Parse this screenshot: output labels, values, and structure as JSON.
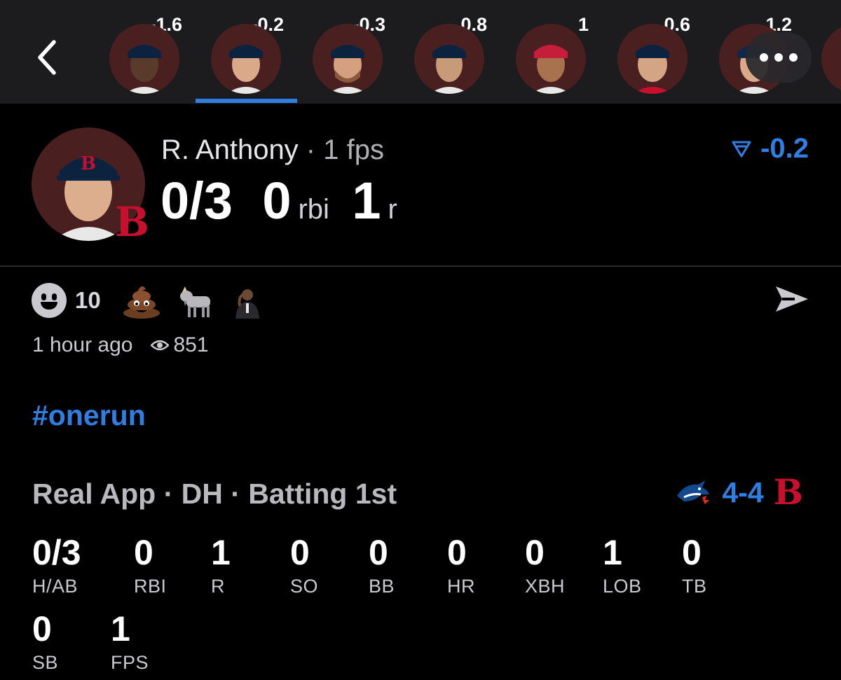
{
  "top_strip": {
    "players": [
      {
        "delta": "-1.6"
      },
      {
        "delta": "-0.2",
        "active": true
      },
      {
        "delta": "-0.3"
      },
      {
        "delta": "0.8"
      },
      {
        "delta": "1"
      },
      {
        "delta": "0.6"
      },
      {
        "delta": "1.2"
      }
    ]
  },
  "player": {
    "name": "R. Anthony",
    "separator": " · ",
    "fps_label": "1 fps",
    "hits_ab": "0/3",
    "rbi": "0",
    "rbi_unit": "rbi",
    "runs": "1",
    "runs_unit": "r",
    "delta": "-0.2"
  },
  "reactions": {
    "count": "10",
    "time": "1 hour ago",
    "views": "851"
  },
  "hashtag": "#onerun",
  "game": {
    "line": "Real App · DH · Batting 1st",
    "score": "4-4"
  },
  "stats": [
    {
      "value": "0/3",
      "label": "H/AB"
    },
    {
      "value": "0",
      "label": "RBI"
    },
    {
      "value": "1",
      "label": "R"
    },
    {
      "value": "0",
      "label": "SO"
    },
    {
      "value": "0",
      "label": "BB"
    },
    {
      "value": "0",
      "label": "HR"
    },
    {
      "value": "0",
      "label": "XBH"
    },
    {
      "value": "1",
      "label": "LOB"
    },
    {
      "value": "0",
      "label": "TB"
    },
    {
      "value": "0",
      "label": "SB"
    },
    {
      "value": "1",
      "label": "FPS"
    }
  ],
  "colors": {
    "accent": "#2f7fe3",
    "redsox": "#c8102e",
    "topbar": "#1c1c1e"
  }
}
